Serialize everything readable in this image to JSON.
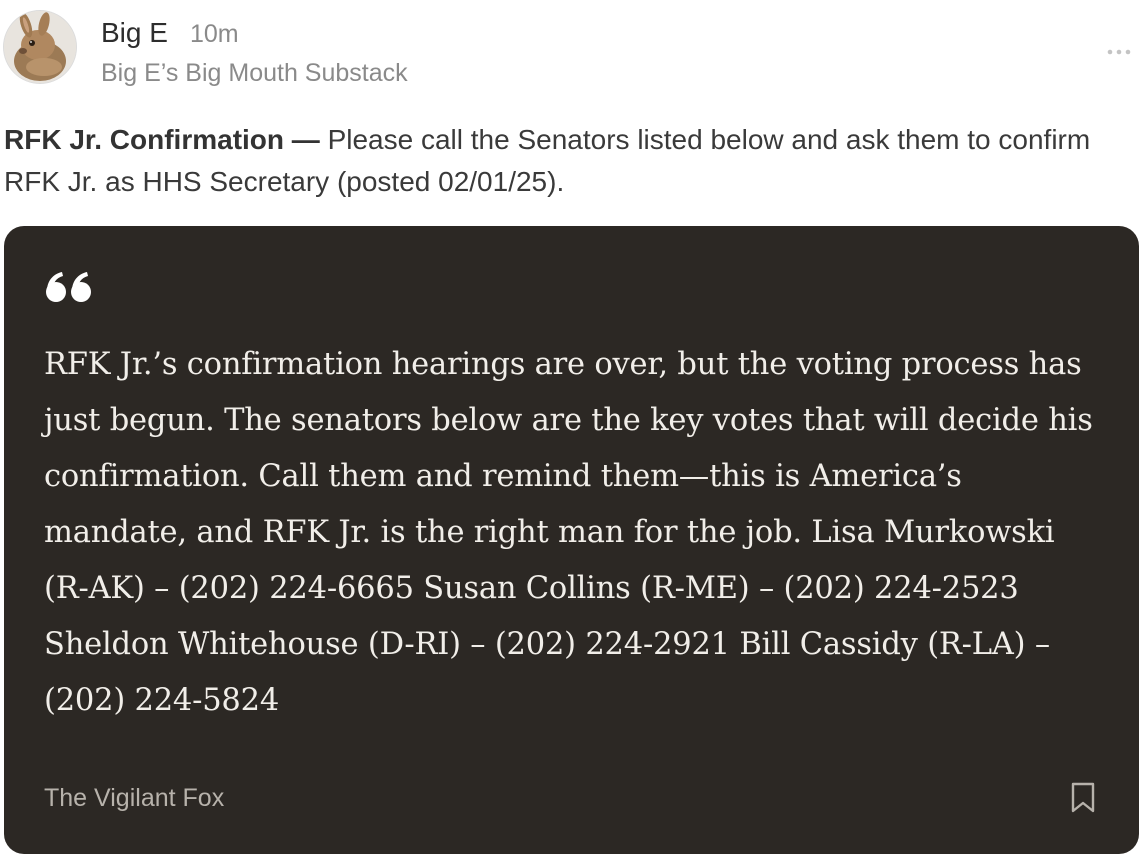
{
  "post": {
    "author": "Big E",
    "time": "10m",
    "publication": "Big E’s Big Mouth Substack",
    "text_bold": "RFK Jr. Confirmation —",
    "text_rest": " Please call the Senators listed below and ask them to confirm RFK Jr. as HHS Secretary (posted 02/01/25)."
  },
  "quote": {
    "body": "RFK Jr.’s confirmation hearings are over, but the voting process has just begun. The senators below are the key votes that will decide his confirmation. Call them and remind them—this is America’s mandate, and RFK Jr. is the right man for the job. Lisa Murkowski (R-AK) – (202) 224-6665 Susan Collins (R-ME) – (202) 224-2523 Sheldon Whitehouse (D-RI) – (202) 224-2921 Bill Cassidy (R-LA) – (202) 224-5824",
    "source": "The Vigilant Fox"
  },
  "icons": {
    "more": "more-horizontal-icon",
    "quote": "quote-mark-icon",
    "bookmark": "bookmark-icon"
  },
  "colors": {
    "card_background": "#2c2824",
    "quote_text": "#f1eee9",
    "muted_text": "#8a8a8a"
  }
}
